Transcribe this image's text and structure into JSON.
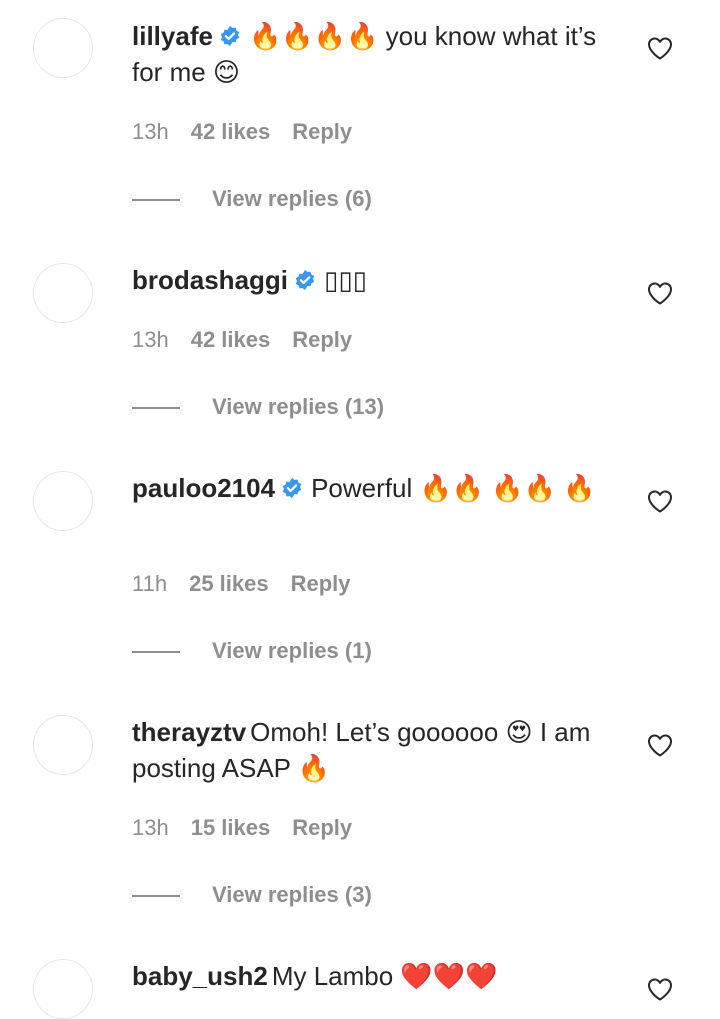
{
  "comments": [
    {
      "username": "lillyafe",
      "verified": true,
      "text": "🔥🔥🔥🔥 you know what it’s for me 😊",
      "time": "13h",
      "likes": "42 likes",
      "reply": "Reply",
      "view_replies": "View replies (6)"
    },
    {
      "username": "brodashaggi",
      "verified": true,
      "text": "▯▯▯",
      "time": "13h",
      "likes": "42 likes",
      "reply": "Reply",
      "view_replies": "View replies (13)"
    },
    {
      "username": "pauloo2104",
      "verified": true,
      "text": "Powerful 🔥🔥 🔥🔥 🔥",
      "time": "11h",
      "likes": "25 likes",
      "reply": "Reply",
      "view_replies": "View replies (1)"
    },
    {
      "username": "therayztv",
      "verified": false,
      "text": "Omoh! Let’s goooooo 😍 I am posting ASAP 🔥",
      "time": "13h",
      "likes": "15 likes",
      "reply": "Reply",
      "view_replies": "View replies (3)"
    },
    {
      "username": "baby_ush2",
      "verified": false,
      "text": "My Lambo ❤️❤️❤️"
    }
  ],
  "colors": {
    "primary_text": "#262626",
    "secondary_text": "#8e8e8e",
    "verified_blue": "#3897f0"
  },
  "icons": {
    "like": "heart-outline-icon",
    "verified": "verified-badge-icon"
  }
}
